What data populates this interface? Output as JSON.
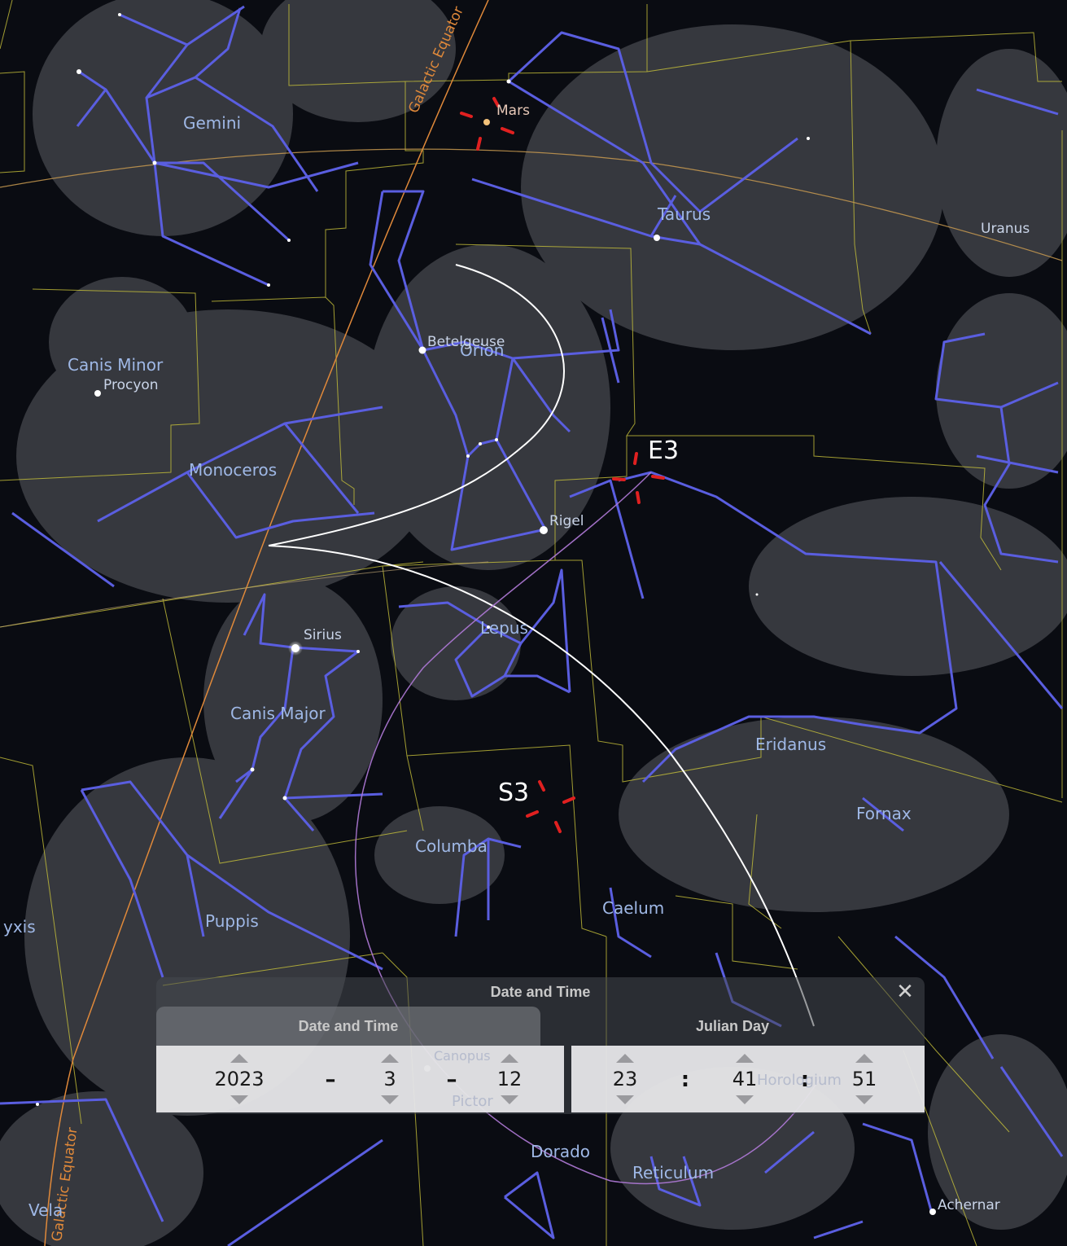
{
  "sky": {
    "constellations": [
      "Gemini",
      "Taurus",
      "Orion",
      "Canis Minor",
      "Monoceros",
      "Lepus",
      "Canis Major",
      "Eridanus",
      "Fornax",
      "Columba",
      "Caelum",
      "Puppis",
      "Dorado",
      "Reticulum",
      "Vela",
      "yxis"
    ],
    "stars": [
      "Betelgeuse",
      "Procyon",
      "Rigel",
      "Sirius",
      "Achernar",
      "Canopus"
    ],
    "planets": [
      "Mars",
      "Uranus"
    ],
    "markers": [
      "E3",
      "S3"
    ],
    "equator_label": "Galactic Equator",
    "faint_labels": [
      "Horologium",
      "Pictor"
    ]
  },
  "dialog": {
    "title": "Date and Time",
    "close": "✕",
    "tabs": [
      "Date and Time",
      "Julian Day"
    ],
    "date": {
      "year": "2023",
      "month": "3",
      "day": "12",
      "sep": "–"
    },
    "time": {
      "hour": "23",
      "minute": "41",
      "second": "51",
      "sep": ":"
    }
  },
  "colors": {
    "sky_bg": "#0a0c12",
    "constellation_line": "#5a5ee0",
    "boundary": "#c8c23a",
    "galactic_equator": "#e0893a",
    "ecliptic": "#c89a50",
    "marker": "#e02020",
    "trajectory": "#ffffff",
    "circle": "#b07ad8"
  }
}
